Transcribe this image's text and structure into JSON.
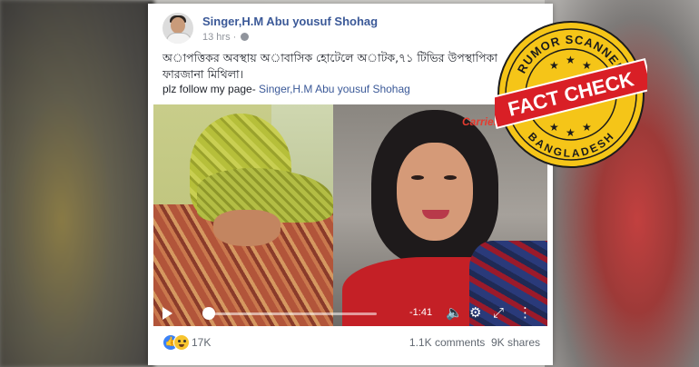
{
  "post": {
    "author": "Singer,H.M Abu yousuf Shohag",
    "time": "13 hrs ·",
    "text_line1": "অাপত্তিকর অবস্থায় অাবাসিক হোটেলে অাটক,৭১ টিভির উপস্থাপিকা",
    "text_line2": "ফারজানা মিথিলা।",
    "follow_prefix": "plz follow my page- ",
    "follow_link": "Singer,H.M Abu yousuf Shohag"
  },
  "video": {
    "watermark": "Carrier City",
    "time_remaining": "-1:41",
    "progress": 0.02
  },
  "footer": {
    "reaction_count": "17K",
    "comments": "1.1K comments",
    "shares": "9K shares"
  },
  "stamp": {
    "top_text": "RUMOR SCANNER",
    "banner": "FACT CHECK",
    "bottom_text": "BANGLADESH",
    "colors": {
      "gold": "#f5c518",
      "red": "#d91f26",
      "dark": "#1b1b1b"
    }
  },
  "icons": [
    "globe-icon",
    "play-icon",
    "volume-icon",
    "settings-icon",
    "fullscreen-icon",
    "more-icon",
    "like-reaction-icon",
    "haha-reaction-icon"
  ]
}
